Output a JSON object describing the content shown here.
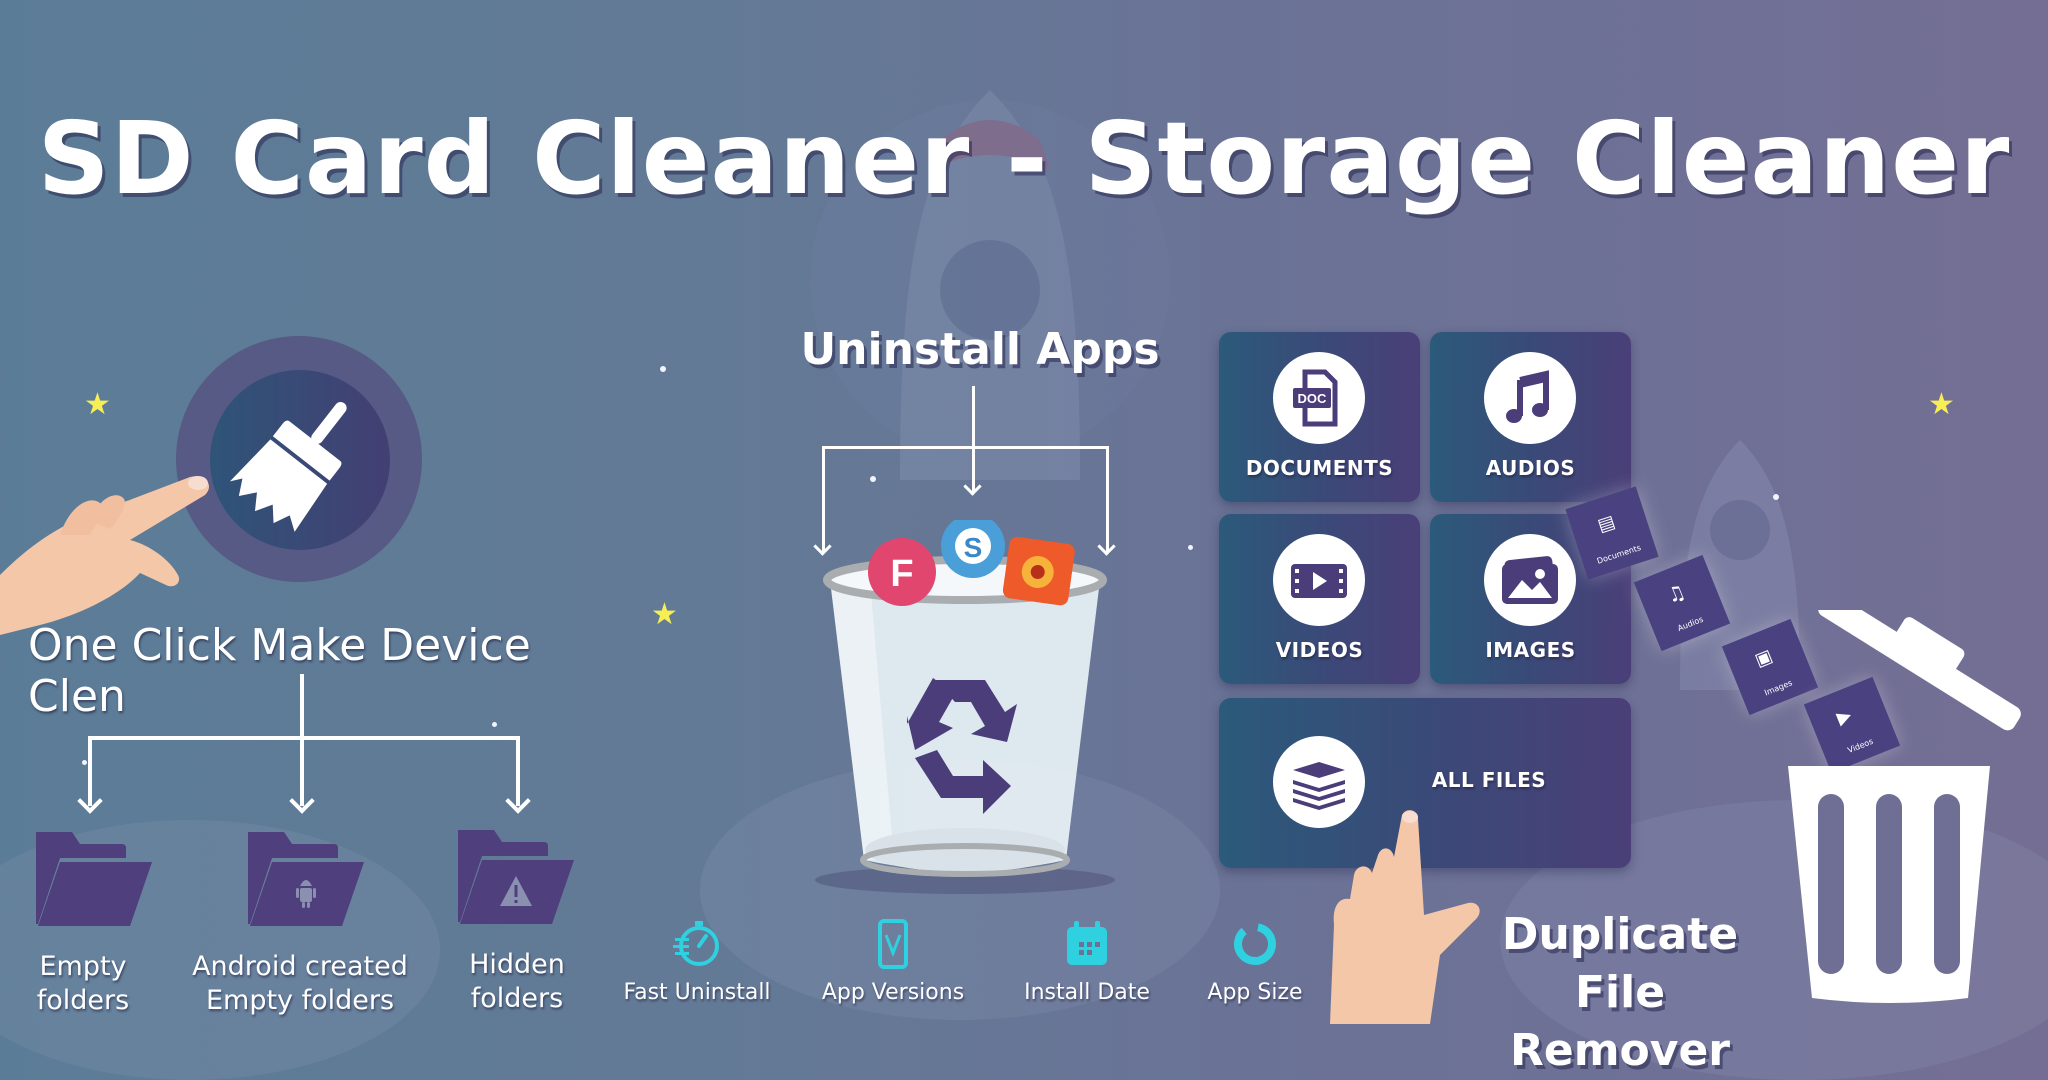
{
  "title": "SD Card Cleaner - Storage Cleaner",
  "left_section": {
    "heading": "One Click Make Device Clen",
    "button_icon": "broom-icon",
    "folders": [
      {
        "label_line1": "Empty",
        "label_line2": "folders",
        "icon": "folder-icon"
      },
      {
        "label_line1": "Android created",
        "label_line2": "Empty folders",
        "icon": "android-folder-icon"
      },
      {
        "label_line1": "Hidden",
        "label_line2": "folders",
        "icon": "warning-folder-icon"
      }
    ]
  },
  "center_section": {
    "heading": "Uninstall Apps",
    "app_icons": [
      {
        "name": "foursquare-app-icon",
        "color": "#e0466e",
        "glyph": "F"
      },
      {
        "name": "skype-app-icon",
        "color": "#4a9fd8",
        "glyph": "S"
      },
      {
        "name": "maps-app-icon",
        "color": "#ef5a2a",
        "glyph": "●"
      }
    ],
    "features": [
      {
        "label": "Fast Uninstall",
        "icon": "stopwatch-icon"
      },
      {
        "label": "App Versions",
        "icon": "phone-version-icon"
      },
      {
        "label": "Install Date",
        "icon": "calendar-icon"
      },
      {
        "label": "App Size",
        "icon": "donut-chart-icon"
      }
    ],
    "accent": "#2fd0e0"
  },
  "right_section": {
    "tiles": [
      {
        "label": "DOCUMENTS",
        "icon": "doc-file-icon",
        "icon_text": "DOC"
      },
      {
        "label": "AUDIOS",
        "icon": "music-note-icon"
      },
      {
        "label": "VIDEOS",
        "icon": "video-film-icon"
      },
      {
        "label": "IMAGES",
        "icon": "image-gallery-icon"
      },
      {
        "label": "ALL FILES",
        "icon": "layers-stack-icon"
      }
    ],
    "flying_tiles": [
      {
        "label": "Documents"
      },
      {
        "label": "Audios"
      },
      {
        "label": "Images"
      },
      {
        "label": "Videos"
      }
    ],
    "heading_line1": "Duplicate",
    "heading_line2": "File Remover"
  },
  "colors": {
    "tile_purple": "#4a3f78",
    "folder_purple": "#4f3f7d",
    "star_yellow": "#f6ee54"
  }
}
